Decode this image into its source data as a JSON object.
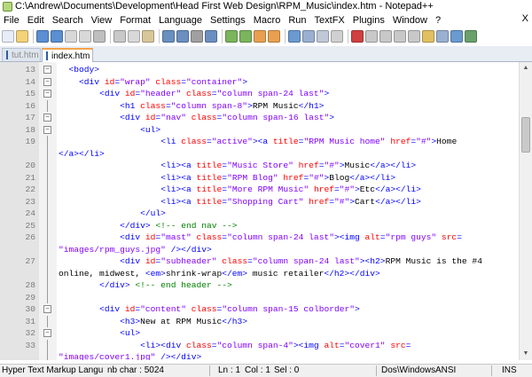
{
  "window": {
    "title": "C:\\Andrew\\Documents\\Development\\Head First Web Design\\RPM_Music\\index.htm - Notepad++"
  },
  "menu": {
    "items": [
      "File",
      "Edit",
      "Search",
      "View",
      "Format",
      "Language",
      "Settings",
      "Macro",
      "Run",
      "TextFX",
      "Plugins",
      "Window",
      "?"
    ],
    "close_glyph": "X"
  },
  "toolbar": {
    "icons": [
      "new-file-icon",
      "open-file-icon",
      "save-icon",
      "save-all-icon",
      "close-icon",
      "close-all-icon",
      "print-icon",
      "cut-icon",
      "copy-icon",
      "paste-icon",
      "undo-icon",
      "redo-icon",
      "find-icon",
      "replace-icon",
      "zoom-in-icon",
      "zoom-out-icon",
      "sync-v-icon",
      "sync-h-icon",
      "wrap-icon",
      "all-chars-icon",
      "indent-guide-icon",
      "user-lang-icon",
      "record-macro-icon",
      "stop-record-icon",
      "play-macro-icon",
      "play-multiple-icon",
      "save-macro-icon",
      "trim-icon",
      "doc-map-icon",
      "function-list-icon",
      "spellcheck-icon"
    ]
  },
  "tabs": [
    {
      "label": "tut.htm",
      "active": false
    },
    {
      "label": "index.htm",
      "active": true
    }
  ],
  "editor": {
    "lines": [
      {
        "num": "13",
        "fold": "minus",
        "indent": 2,
        "parts": [
          [
            "tag",
            "<body>"
          ]
        ]
      },
      {
        "num": "14",
        "fold": "minus",
        "indent": 4,
        "parts": [
          [
            "tag",
            "<div "
          ],
          [
            "attr",
            "id"
          ],
          [
            "tag",
            "="
          ],
          [
            "val",
            "\"wrap\""
          ],
          [
            "tag",
            " "
          ],
          [
            "attr",
            "class"
          ],
          [
            "tag",
            "="
          ],
          [
            "val",
            "\"container\""
          ],
          [
            "tag",
            ">"
          ]
        ]
      },
      {
        "num": "15",
        "fold": "minus",
        "indent": 8,
        "parts": [
          [
            "tag",
            "<div "
          ],
          [
            "attr",
            "id"
          ],
          [
            "tag",
            "="
          ],
          [
            "val",
            "\"header\""
          ],
          [
            "tag",
            " "
          ],
          [
            "attr",
            "class"
          ],
          [
            "tag",
            "="
          ],
          [
            "val",
            "\"column span-24 last\""
          ],
          [
            "tag",
            ">"
          ]
        ]
      },
      {
        "num": "16",
        "fold": "line",
        "indent": 12,
        "parts": [
          [
            "tag",
            "<h1 "
          ],
          [
            "attr",
            "class"
          ],
          [
            "tag",
            "="
          ],
          [
            "val",
            "\"column span-8\""
          ],
          [
            "tag",
            ">"
          ],
          [
            "txt",
            "RPM Music"
          ],
          [
            "tag",
            "</h1>"
          ]
        ]
      },
      {
        "num": "17",
        "fold": "minus",
        "indent": 12,
        "parts": [
          [
            "tag",
            "<div "
          ],
          [
            "attr",
            "id"
          ],
          [
            "tag",
            "="
          ],
          [
            "val",
            "\"nav\""
          ],
          [
            "tag",
            " "
          ],
          [
            "attr",
            "class"
          ],
          [
            "tag",
            "="
          ],
          [
            "val",
            "\"column span-16 last\""
          ],
          [
            "tag",
            ">"
          ]
        ]
      },
      {
        "num": "18",
        "fold": "minus",
        "indent": 16,
        "parts": [
          [
            "tag",
            "<ul>"
          ]
        ]
      },
      {
        "num": "19",
        "fold": "line",
        "indent": 20,
        "parts": [
          [
            "tag",
            "<li "
          ],
          [
            "attr",
            "class"
          ],
          [
            "tag",
            "="
          ],
          [
            "val",
            "\"active\""
          ],
          [
            "tag",
            "><a "
          ],
          [
            "attr",
            "title"
          ],
          [
            "tag",
            "="
          ],
          [
            "val",
            "\"RPM Music home\""
          ],
          [
            "tag",
            " "
          ],
          [
            "attr",
            "href"
          ],
          [
            "tag",
            "="
          ],
          [
            "val",
            "\"#\""
          ],
          [
            "tag",
            ">"
          ],
          [
            "txt",
            "Home"
          ]
        ]
      },
      {
        "num": "",
        "fold": "line",
        "indent": 0,
        "wrap": true,
        "parts": [
          [
            "tag",
            "</a></li>"
          ]
        ]
      },
      {
        "num": "20",
        "fold": "line",
        "indent": 20,
        "parts": [
          [
            "tag",
            "<li><a "
          ],
          [
            "attr",
            "title"
          ],
          [
            "tag",
            "="
          ],
          [
            "val",
            "\"Music Store\""
          ],
          [
            "tag",
            " "
          ],
          [
            "attr",
            "href"
          ],
          [
            "tag",
            "="
          ],
          [
            "val",
            "\"#\""
          ],
          [
            "tag",
            ">"
          ],
          [
            "txt",
            "Music"
          ],
          [
            "tag",
            "</a></li>"
          ]
        ]
      },
      {
        "num": "21",
        "fold": "line",
        "indent": 20,
        "parts": [
          [
            "tag",
            "<li><a "
          ],
          [
            "attr",
            "title"
          ],
          [
            "tag",
            "="
          ],
          [
            "val",
            "\"RPM Blog\""
          ],
          [
            "tag",
            " "
          ],
          [
            "attr",
            "href"
          ],
          [
            "tag",
            "="
          ],
          [
            "val",
            "\"#\""
          ],
          [
            "tag",
            ">"
          ],
          [
            "txt",
            "Blog"
          ],
          [
            "tag",
            "</a></li>"
          ]
        ]
      },
      {
        "num": "22",
        "fold": "line",
        "indent": 20,
        "parts": [
          [
            "tag",
            "<li><a "
          ],
          [
            "attr",
            "title"
          ],
          [
            "tag",
            "="
          ],
          [
            "val",
            "\"More RPM Music\""
          ],
          [
            "tag",
            " "
          ],
          [
            "attr",
            "href"
          ],
          [
            "tag",
            "="
          ],
          [
            "val",
            "\"#\""
          ],
          [
            "tag",
            ">"
          ],
          [
            "txt",
            "Etc"
          ],
          [
            "tag",
            "</a></li>"
          ]
        ]
      },
      {
        "num": "23",
        "fold": "line",
        "indent": 20,
        "parts": [
          [
            "tag",
            "<li><a "
          ],
          [
            "attr",
            "title"
          ],
          [
            "tag",
            "="
          ],
          [
            "val",
            "\"Shopping Cart\""
          ],
          [
            "tag",
            " "
          ],
          [
            "attr",
            "href"
          ],
          [
            "tag",
            "="
          ],
          [
            "val",
            "\"#\""
          ],
          [
            "tag",
            ">"
          ],
          [
            "txt",
            "Cart"
          ],
          [
            "tag",
            "</a></li>"
          ]
        ]
      },
      {
        "num": "24",
        "fold": "end",
        "indent": 16,
        "parts": [
          [
            "tag",
            "</ul>"
          ]
        ]
      },
      {
        "num": "25",
        "fold": "end",
        "indent": 12,
        "parts": [
          [
            "tag",
            "</div>"
          ],
          [
            "txt",
            " "
          ],
          [
            "cmt",
            "<!-- end nav -->"
          ]
        ]
      },
      {
        "num": "26",
        "fold": "line",
        "indent": 12,
        "parts": [
          [
            "tag",
            "<div "
          ],
          [
            "attr",
            "id"
          ],
          [
            "tag",
            "="
          ],
          [
            "val",
            "\"mast\""
          ],
          [
            "tag",
            " "
          ],
          [
            "attr",
            "class"
          ],
          [
            "tag",
            "="
          ],
          [
            "val",
            "\"column span-24 last\""
          ],
          [
            "tag",
            "><img "
          ],
          [
            "attr",
            "alt"
          ],
          [
            "tag",
            "="
          ],
          [
            "val",
            "\"rpm guys\""
          ],
          [
            "tag",
            " "
          ],
          [
            "attr",
            "src"
          ],
          [
            "tag",
            "="
          ]
        ]
      },
      {
        "num": "",
        "fold": "line",
        "indent": 0,
        "wrap": true,
        "parts": [
          [
            "val",
            "\"images/rpm_guys.jpg\""
          ],
          [
            "tag",
            " /></div>"
          ]
        ]
      },
      {
        "num": "27",
        "fold": "line",
        "indent": 12,
        "parts": [
          [
            "tag",
            "<div "
          ],
          [
            "attr",
            "id"
          ],
          [
            "tag",
            "="
          ],
          [
            "val",
            "\"subheader\""
          ],
          [
            "tag",
            " "
          ],
          [
            "attr",
            "class"
          ],
          [
            "tag",
            "="
          ],
          [
            "val",
            "\"column span-24 last\""
          ],
          [
            "tag",
            "><h2>"
          ],
          [
            "txt",
            "RPM Music is the #4"
          ]
        ]
      },
      {
        "num": "",
        "fold": "line",
        "indent": 0,
        "wrap": true,
        "parts": [
          [
            "txt",
            "online, midwest, "
          ],
          [
            "tag",
            "<em>"
          ],
          [
            "txt",
            "shrink-wrap"
          ],
          [
            "tag",
            "</em>"
          ],
          [
            "txt",
            " music retailer"
          ],
          [
            "tag",
            "</h2></div>"
          ]
        ]
      },
      {
        "num": "28",
        "fold": "end",
        "indent": 8,
        "parts": [
          [
            "tag",
            "</div>"
          ],
          [
            "txt",
            " "
          ],
          [
            "cmt",
            "<!-- end header -->"
          ]
        ]
      },
      {
        "num": "29",
        "fold": "line",
        "indent": 0,
        "parts": []
      },
      {
        "num": "30",
        "fold": "minus",
        "indent": 8,
        "parts": [
          [
            "tag",
            "<div "
          ],
          [
            "attr",
            "id"
          ],
          [
            "tag",
            "="
          ],
          [
            "val",
            "\"content\""
          ],
          [
            "tag",
            " "
          ],
          [
            "attr",
            "class"
          ],
          [
            "tag",
            "="
          ],
          [
            "val",
            "\"column span-15 colborder\""
          ],
          [
            "tag",
            ">"
          ]
        ]
      },
      {
        "num": "31",
        "fold": "line",
        "indent": 12,
        "parts": [
          [
            "tag",
            "<h3>"
          ],
          [
            "txt",
            "New at RPM Music"
          ],
          [
            "tag",
            "</h3>"
          ]
        ]
      },
      {
        "num": "32",
        "fold": "minus",
        "indent": 12,
        "parts": [
          [
            "tag",
            "<ul>"
          ]
        ]
      },
      {
        "num": "33",
        "fold": "line",
        "indent": 16,
        "parts": [
          [
            "tag",
            "<li><div "
          ],
          [
            "attr",
            "class"
          ],
          [
            "tag",
            "="
          ],
          [
            "val",
            "\"column span-4\""
          ],
          [
            "tag",
            "><img "
          ],
          [
            "attr",
            "alt"
          ],
          [
            "tag",
            "="
          ],
          [
            "val",
            "\"cover1\""
          ],
          [
            "tag",
            " "
          ],
          [
            "attr",
            "src"
          ],
          [
            "tag",
            "="
          ]
        ]
      },
      {
        "num": "",
        "fold": "line",
        "indent": 0,
        "wrap": true,
        "parts": [
          [
            "val",
            "\"images/cover1.jpg\""
          ],
          [
            "tag",
            " /></div>"
          ]
        ]
      }
    ]
  },
  "statusbar": {
    "lang": "Hyper Text Markup Langu",
    "nbchar": "nb char : 5024",
    "ln": "Ln : 1",
    "col": "Col : 1",
    "sel": "Sel : 0",
    "eol": "Dos\\Windows",
    "enc": "ANSI",
    "ins": "INS"
  },
  "colors": {
    "tag": "#0000ff",
    "attribute": "#ff0000",
    "value": "#8000ff",
    "comment": "#008000",
    "active_tab_accent": "#f4a34b"
  }
}
